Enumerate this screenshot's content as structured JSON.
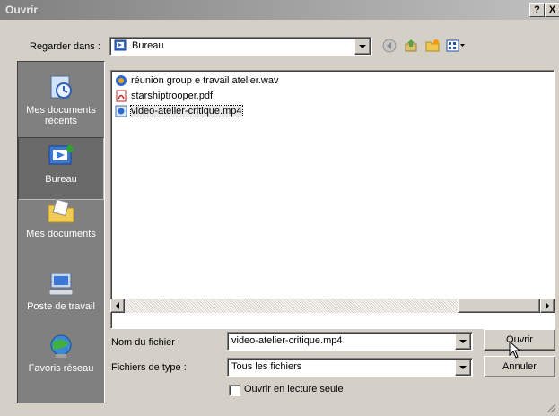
{
  "window": {
    "title": "Ouvrir",
    "help": "?",
    "close": "X"
  },
  "lookin": {
    "label": "Regarder dans :",
    "value": "Bureau"
  },
  "toolbar": [
    "back-icon",
    "up-folder-icon",
    "new-folder-icon",
    "view-menu-icon"
  ],
  "places": [
    {
      "label": "Mes documents récents",
      "line1": "Mes documents",
      "line2": "récents",
      "icon": "recent-documents-icon"
    },
    {
      "label": "Bureau",
      "line1": "Bureau",
      "line2": "",
      "icon": "desktop-icon",
      "selected": true
    },
    {
      "label": "Mes documents",
      "line1": "Mes documents",
      "line2": "",
      "icon": "my-documents-icon"
    },
    {
      "label": "Poste de travail",
      "line1": "Poste de travail",
      "line2": "",
      "icon": "my-computer-icon"
    },
    {
      "label": "Favoris réseau",
      "line1": "Favoris réseau",
      "line2": "",
      "icon": "network-places-icon"
    }
  ],
  "files": [
    {
      "name": "réunion group e travail atelier.wav",
      "icon": "audio-file-icon"
    },
    {
      "name": "starshiptrooper.pdf",
      "icon": "pdf-file-icon"
    },
    {
      "name": "video-atelier-critique.mp4",
      "icon": "video-file-icon",
      "selected": true
    }
  ],
  "filename": {
    "label": "Nom du fichier :",
    "value": "video-atelier-critique.mp4"
  },
  "filetype": {
    "label": "Fichiers de type :",
    "value": "Tous les fichiers"
  },
  "readonly": {
    "label": "Ouvrir en lecture seule",
    "checked": false
  },
  "buttons": {
    "open": "Ouvrir",
    "cancel": "Annuler"
  }
}
